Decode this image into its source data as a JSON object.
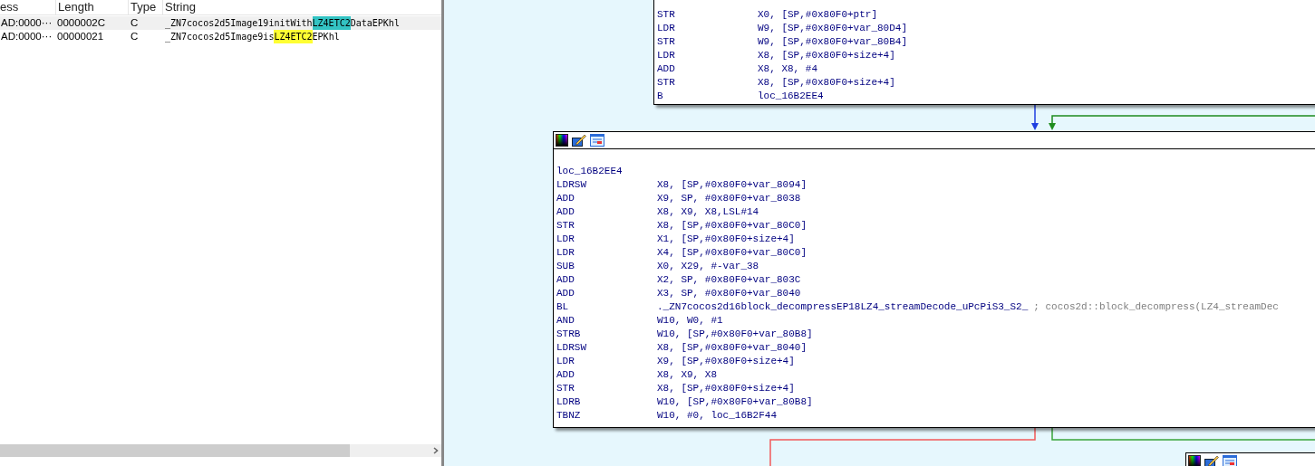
{
  "strings_table": {
    "columns": [
      "ess",
      "Length",
      "Type",
      "String"
    ],
    "rows": [
      {
        "selected": true,
        "address": "AD:0000···",
        "length": "0000002C",
        "type": "C",
        "string": [
          {
            "text": "_ZN7cocos2d5Image19initWith"
          },
          {
            "text": "LZ4ETC2",
            "color": "#33c3c3"
          },
          {
            "text": "DataEPKhl"
          }
        ]
      },
      {
        "selected": false,
        "address": "AD:0000···",
        "length": "00000021",
        "type": "C",
        "string": [
          {
            "text": "_ZN7cocos2d5Image9is"
          },
          {
            "text": "LZ4ETC2",
            "color": "#ffff33"
          },
          {
            "text": "EPKhl"
          }
        ]
      }
    ]
  },
  "graph": {
    "nodes": [
      {
        "kind": "top",
        "lines": [
          {
            "mnemonic": "STR",
            "operands": "X0, [SP,#0x80F0+ptr]"
          },
          {
            "mnemonic": "LDR",
            "operands": "W9, [SP,#0x80F0+var_80D4]"
          },
          {
            "mnemonic": "STR",
            "operands": "W9, [SP,#0x80F0+var_80B4]"
          },
          {
            "mnemonic": "LDR",
            "operands": "X8, [SP,#0x80F0+size+4]"
          },
          {
            "mnemonic": "ADD",
            "operands": "X8, X8, #4"
          },
          {
            "mnemonic": "STR",
            "operands": "X8, [SP,#0x80F0+size+4]"
          },
          {
            "mnemonic": "B",
            "operands": "loc_16B2EE4"
          }
        ]
      },
      {
        "kind": "main",
        "label": "loc_16B2EE4",
        "lines": [
          {
            "mnemonic": "LDRSW",
            "operands": "X8, [SP,#0x80F0+var_8094]"
          },
          {
            "mnemonic": "ADD",
            "operands": "X9, SP, #0x80F0+var_8038"
          },
          {
            "mnemonic": "ADD",
            "operands": "X8, X9, X8,LSL#14"
          },
          {
            "mnemonic": "STR",
            "operands": "X8, [SP,#0x80F0+var_80C0]"
          },
          {
            "mnemonic": "LDR",
            "operands": "X1, [SP,#0x80F0+size+4]"
          },
          {
            "mnemonic": "LDR",
            "operands": "X4, [SP,#0x80F0+var_80C0]"
          },
          {
            "mnemonic": "SUB",
            "operands": "X0, X29, #-var_38"
          },
          {
            "mnemonic": "ADD",
            "operands": "X2, SP, #0x80F0+var_803C"
          },
          {
            "mnemonic": "ADD",
            "operands": "X3, SP, #0x80F0+var_8040"
          },
          {
            "mnemonic": "BL",
            "operands": "._ZN7cocos2d16block_decompressEP18LZ4_streamDecode_uPcPiS3_S2_",
            "comment": "; cocos2d::block_decompress(LZ4_streamDec"
          },
          {
            "mnemonic": "AND",
            "operands": "W10, W0, #1"
          },
          {
            "mnemonic": "STRB",
            "operands": "W10, [SP,#0x80F0+var_80B8]"
          },
          {
            "mnemonic": "LDRSW",
            "operands": "X8, [SP,#0x80F0+var_8040]"
          },
          {
            "mnemonic": "LDR",
            "operands": "X9, [SP,#0x80F0+size+4]"
          },
          {
            "mnemonic": "ADD",
            "operands": "X8, X9, X8"
          },
          {
            "mnemonic": "STR",
            "operands": "X8, [SP,#0x80F0+size+4]"
          },
          {
            "mnemonic": "LDRB",
            "operands": "W10, [SP,#0x80F0+var_80B8]"
          },
          {
            "mnemonic": "TBNZ",
            "operands": "W10, #0, loc_16B2F44"
          }
        ]
      },
      {
        "kind": "stub"
      }
    ]
  }
}
